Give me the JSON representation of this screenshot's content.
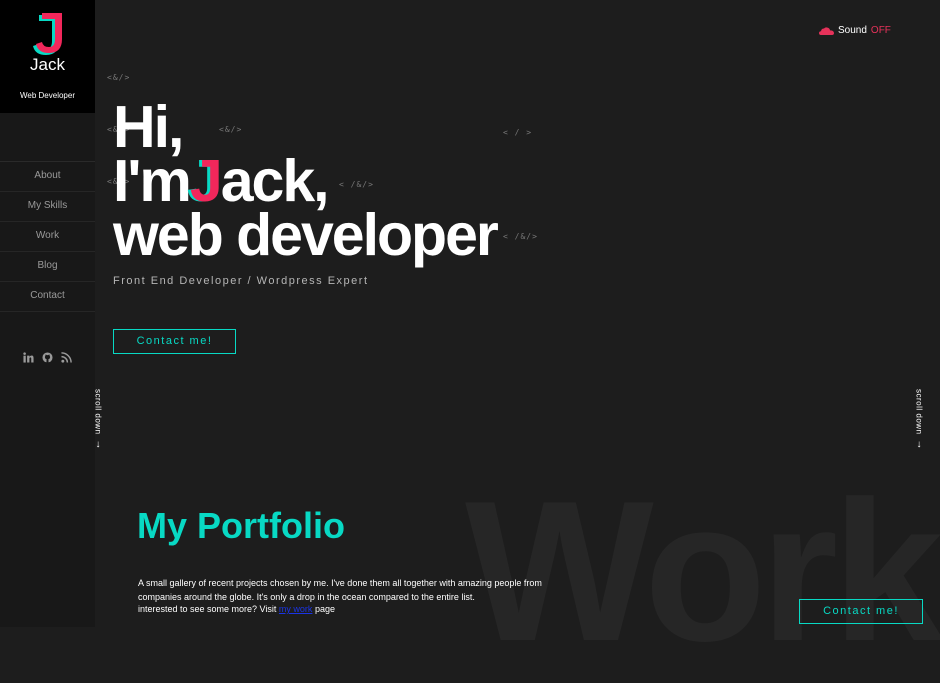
{
  "sidebar": {
    "logo_letter": "J",
    "logo_name": "Jack",
    "logo_role": "Web Developer",
    "nav": [
      "About",
      "My Skills",
      "Work",
      "Blog",
      "Contact"
    ],
    "socials": [
      "linkedin-icon",
      "github-icon",
      "rss-icon"
    ]
  },
  "sound": {
    "label": "Sound",
    "state": "OFF"
  },
  "tags": {
    "t1": "<&/>",
    "t2": "<&/>",
    "t3": "<&/>",
    "t4": "< / >",
    "t5": "<&/>",
    "t6": "< /&/>",
    "t7": "< /&/>"
  },
  "hero": {
    "line1": "Hi,",
    "line2_prefix": "I'm",
    "line2_letter": "J",
    "line2_suffix": "ack,",
    "line3": "web developer",
    "subtitle": "Front End Developer / Wordpress Expert",
    "cta": "Contact me!"
  },
  "scroll": {
    "label": "scroll down",
    "arrow": "↓"
  },
  "portfolio": {
    "bg_word": "Work",
    "title": "My Portfolio",
    "description": "A small gallery of recent projects chosen by me. I've done them all together with amazing people from companies around the globe. It's only a drop in the ocean compared to the entire list.",
    "more_prefix": "interested to see some more? Visit",
    "more_link": "my work",
    "more_suffix": "page",
    "cta": "Contact me!"
  },
  "colors": {
    "accent_teal": "#08d9c4",
    "accent_pink": "#f2275b",
    "background": "#1d1d1d"
  }
}
